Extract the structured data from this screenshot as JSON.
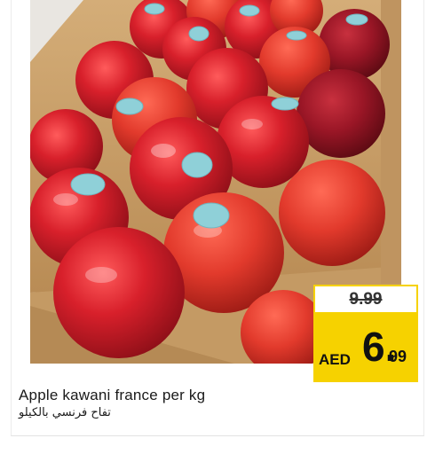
{
  "product": {
    "name_en": "Apple kawani france per kg",
    "name_ar": "تفاح فرنسي بالكيلو",
    "image_alt": "Apples in a cardboard box"
  },
  "price": {
    "old": "9.99",
    "currency": "AED",
    "new_int": "6.",
    "new_dec": "99"
  },
  "colors": {
    "badge_yellow": "#f6d200",
    "apple_red": "#d8202b",
    "box_brown": "#c9a06a",
    "sticker_blue": "#8fd0d8"
  }
}
